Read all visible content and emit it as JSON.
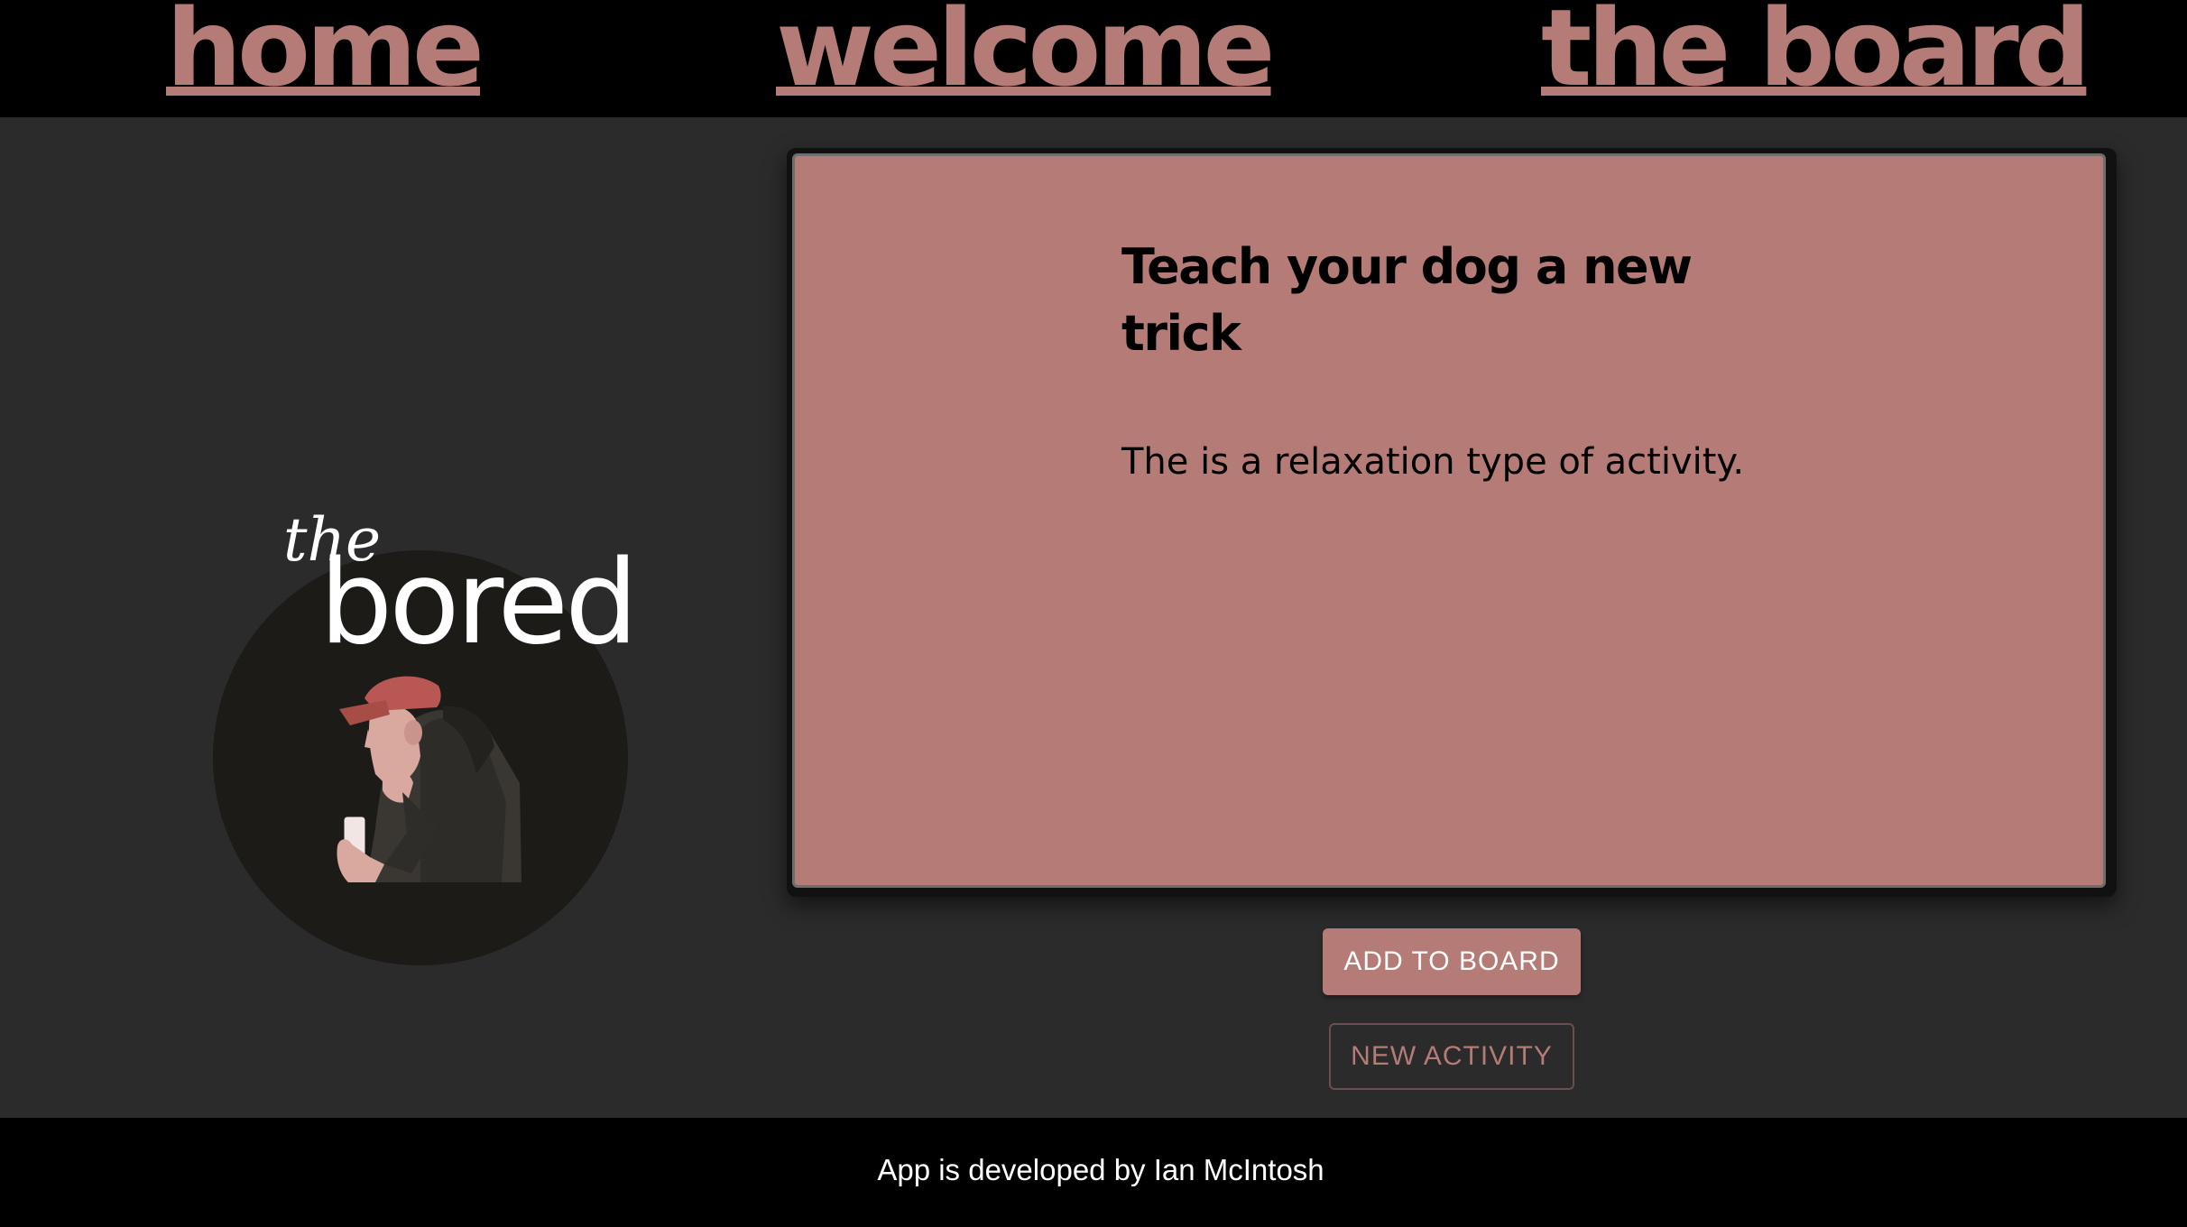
{
  "nav": {
    "home_label": "home",
    "welcome_label": "welcome",
    "board_label": "the board"
  },
  "logo": {
    "the": "the",
    "bored": "bored"
  },
  "activity": {
    "title": "Teach your dog a new trick",
    "type_text": "The is a relaxation type of activity."
  },
  "buttons": {
    "add_label": "ADD TO BOARD",
    "new_label": "NEW ACTIVITY"
  },
  "footer": {
    "credit": "App is developed by Ian McIntosh"
  },
  "colors": {
    "accent": "#b47b77",
    "nav_bg": "#000000",
    "main_bg": "#2b2b2b",
    "footer_bg": "#000000",
    "logo_circle": "#1d1b18"
  },
  "icons": {
    "logo_illustration": "person-with-phone-illustration"
  }
}
